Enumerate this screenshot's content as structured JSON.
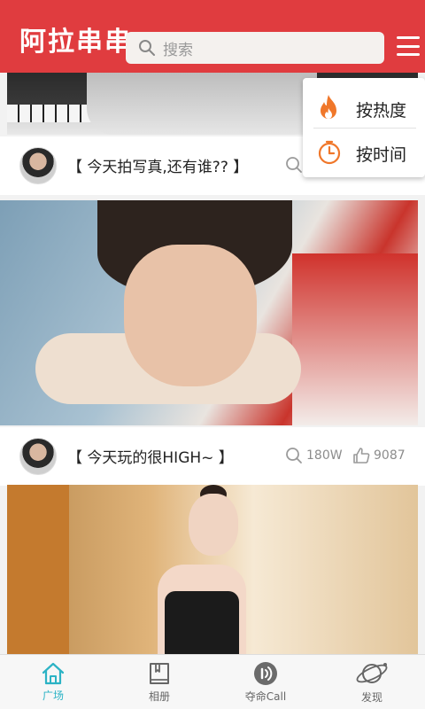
{
  "header": {
    "title": "阿拉串串",
    "search_placeholder": "搜索"
  },
  "dropdown": {
    "items": [
      {
        "label": "按热度",
        "icon": "fire-icon"
      },
      {
        "label": "按时间",
        "icon": "clock-icon"
      }
    ]
  },
  "posts": [
    {
      "title": "【 今天拍写真,还有谁?? 】"
    },
    {
      "title": "【 今天玩的很HIGH~ 】",
      "views": "180W",
      "likes": "9087"
    }
  ],
  "tabbar": {
    "tabs": [
      {
        "label": "广场",
        "icon": "home-icon",
        "active": true
      },
      {
        "label": "相册",
        "icon": "album-icon",
        "active": false
      },
      {
        "label": "夺命Call",
        "icon": "call-icon",
        "active": false
      },
      {
        "label": "发现",
        "icon": "planet-icon",
        "active": false
      }
    ]
  },
  "colors": {
    "brand": "#e03c3f",
    "tab_active": "#2cb3c5",
    "dropdown_icon": "#f0772a"
  }
}
